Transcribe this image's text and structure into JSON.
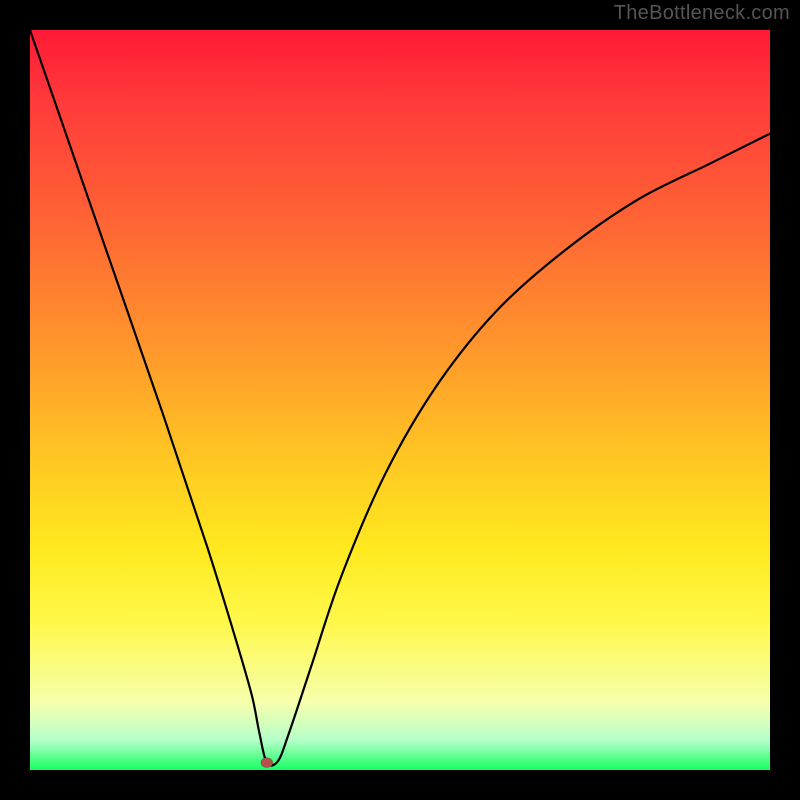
{
  "watermark": "TheBottleneck.com",
  "chart_data": {
    "type": "line",
    "title": "",
    "xlabel": "",
    "ylabel": "",
    "xlim": [
      0,
      100
    ],
    "ylim": [
      0,
      100
    ],
    "grid": false,
    "legend": false,
    "series": [
      {
        "name": "bottleneck-curve",
        "x": [
          0,
          9,
          18,
          24,
          28,
          30,
          31,
          32,
          33.5,
          35,
          38,
          42,
          48,
          55,
          63,
          72,
          82,
          92,
          100
        ],
        "values": [
          100,
          74,
          48,
          30,
          17,
          10,
          5,
          1,
          1.2,
          5,
          14,
          26,
          40,
          52,
          62,
          70,
          77,
          82,
          86
        ]
      }
    ],
    "marker": {
      "x": 32,
      "y": 1,
      "name": "optimal-point"
    },
    "gradient_stops": [
      {
        "pos": 0,
        "color": "#ff1a35"
      },
      {
        "pos": 10,
        "color": "#ff3b3b"
      },
      {
        "pos": 28,
        "color": "#ff6a33"
      },
      {
        "pos": 44,
        "color": "#ff9a2b"
      },
      {
        "pos": 58,
        "color": "#ffc723"
      },
      {
        "pos": 70,
        "color": "#ffe91f"
      },
      {
        "pos": 80,
        "color": "#fff84a"
      },
      {
        "pos": 91,
        "color": "#f6ffae"
      },
      {
        "pos": 96,
        "color": "#b4ffc8"
      },
      {
        "pos": 100,
        "color": "#17ff63"
      }
    ]
  }
}
